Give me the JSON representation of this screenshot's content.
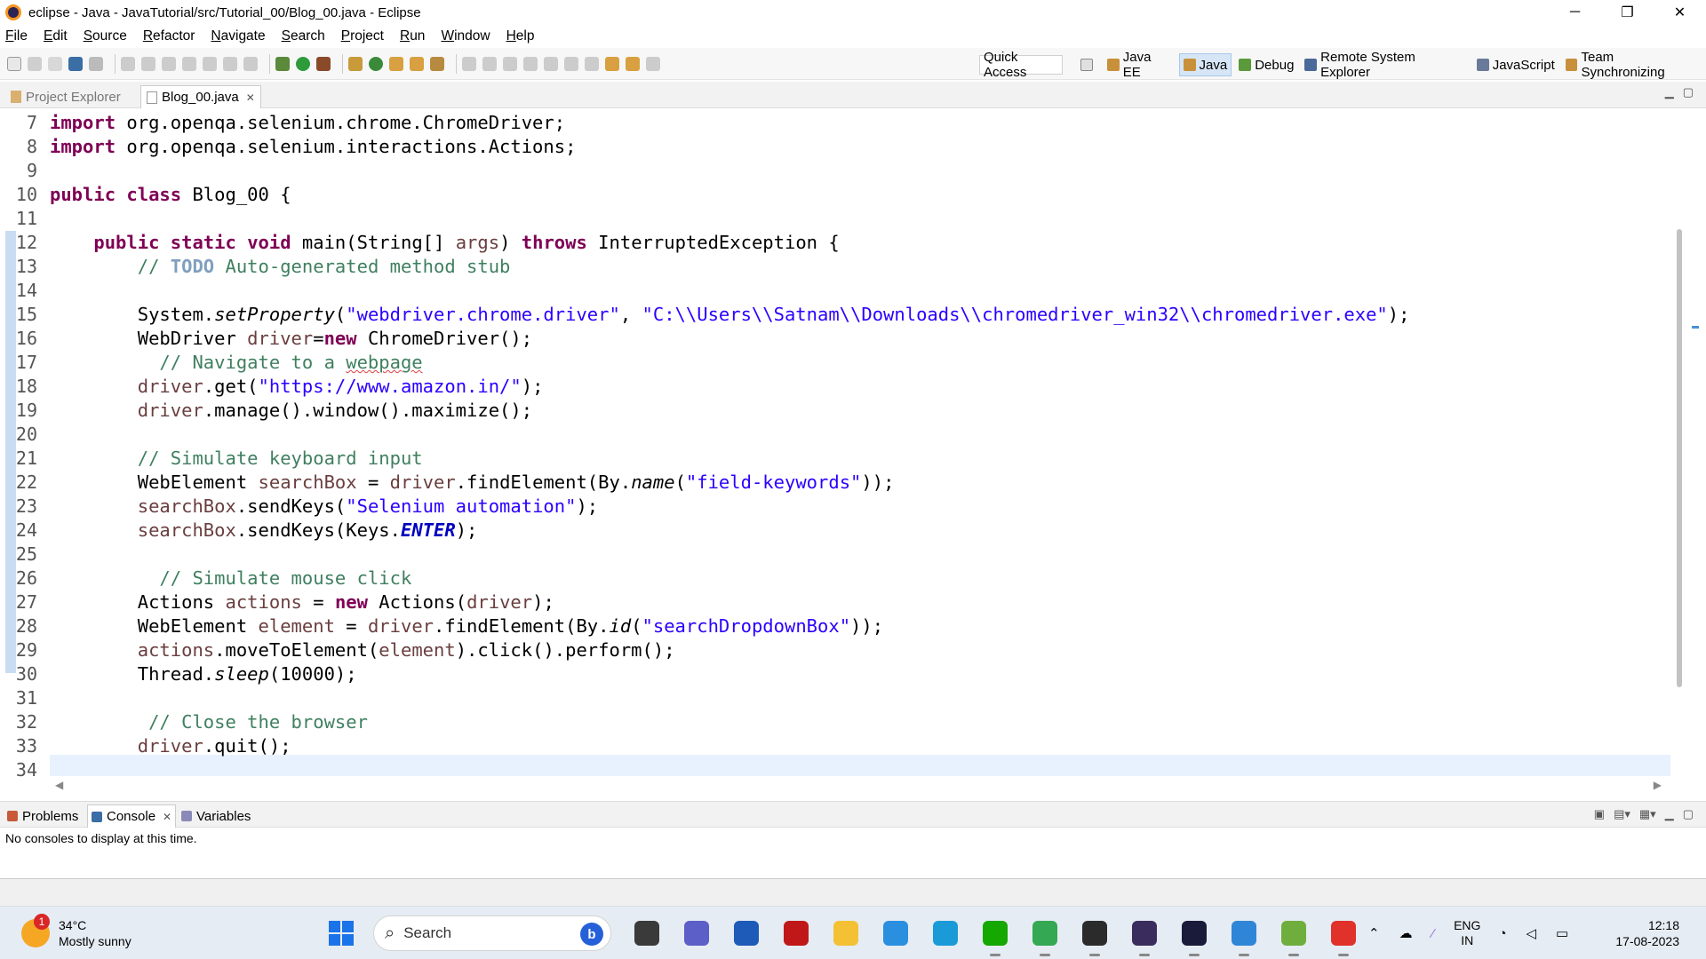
{
  "window": {
    "title": "eclipse - Java - JavaTutorial/src/Tutorial_00/Blog_00.java - Eclipse",
    "min": "─",
    "max": "❐",
    "close": "✕"
  },
  "menu": [
    "File",
    "Edit",
    "Source",
    "Refactor",
    "Navigate",
    "Search",
    "Project",
    "Run",
    "Window",
    "Help"
  ],
  "toolbar": {
    "quick_access": "Quick Access"
  },
  "perspectives": [
    {
      "label": "Java EE",
      "active": false
    },
    {
      "label": "Java",
      "active": true
    },
    {
      "label": "Debug",
      "active": false
    },
    {
      "label": "Remote System Explorer",
      "active": false
    },
    {
      "label": "JavaScript",
      "active": false
    },
    {
      "label": "Team Synchronizing",
      "active": false
    }
  ],
  "editor_tabs": {
    "project_explorer": "Project Explorer",
    "file": "Blog_00.java",
    "close": "✕"
  },
  "code": {
    "ln": [
      "7",
      "8",
      "9",
      "10",
      "11",
      "12",
      "13",
      "14",
      "15",
      "16",
      "17",
      "18",
      "19",
      "20",
      "21",
      "22",
      "23",
      "24",
      "25",
      "26",
      "27",
      "28",
      "29",
      "30",
      "31",
      "32",
      "33",
      "34"
    ],
    "imp1_kw": "import",
    "imp1": " org.openqa.selenium.chrome.ChromeDriver;",
    "imp2_kw": "import",
    "imp2": " org.openqa.selenium.interactions.Actions;",
    "cls_kw1": "public",
    "cls_kw2": "class",
    "cls": " Blog_00 {",
    "main_kw1": "public",
    "main_kw2": "static",
    "main_kw3": "void",
    "main_a": " main(String[] ",
    "main_args": "args",
    "main_b": ") ",
    "main_kw4": "throws",
    "main_c": " InterruptedException {",
    "todo_pre": "// ",
    "todo": "TODO",
    "todo_post": " Auto-generated method stub",
    "l15_a": "System.",
    "l15_m": "setProperty",
    "l15_b": "(",
    "l15_s1": "\"webdriver.chrome.driver\"",
    "l15_c": ", ",
    "l15_s2": "\"C:\\\\Users\\\\Satnam\\\\Downloads\\\\chromedriver_win32\\\\chromedriver.exe\"",
    "l15_d": ");",
    "l16_a": "WebDriver ",
    "l16_v": "driver",
    "l16_b": "=",
    "l16_kw": "new",
    "l16_c": " ChromeDriver();",
    "l17_a": "  // Navigate to a ",
    "l17_sq": "webpage",
    "l18_v": "driver",
    "l18_a": ".get(",
    "l18_s": "\"https://www.amazon.in/\"",
    "l18_b": ");",
    "l19_v": "driver",
    "l19_a": ".manage().window().maximize();",
    "l21": "// Simulate keyboard input",
    "l22_a": "WebElement ",
    "l22_v": "searchBox",
    "l22_b": " = ",
    "l22_v2": "driver",
    "l22_c": ".findElement(By.",
    "l22_m": "name",
    "l22_d": "(",
    "l22_s": "\"field-keywords\"",
    "l22_e": "));",
    "l23_v": "searchBox",
    "l23_a": ".sendKeys(",
    "l23_s": "\"Selenium automation\"",
    "l23_b": ");",
    "l24_v": "searchBox",
    "l24_a": ".sendKeys(Keys.",
    "l24_k": "ENTER",
    "l24_b": ");",
    "l26": "  // Simulate mouse click",
    "l27_a": "Actions ",
    "l27_v": "actions",
    "l27_b": " = ",
    "l27_kw": "new",
    "l27_c": " Actions(",
    "l27_v2": "driver",
    "l27_d": ");",
    "l28_a": "WebElement ",
    "l28_v": "element",
    "l28_b": " = ",
    "l28_v2": "driver",
    "l28_c": ".findElement(By.",
    "l28_m": "id",
    "l28_d": "(",
    "l28_s": "\"searchDropdownBox\"",
    "l28_e": "));",
    "l29_v": "actions",
    "l29_a": ".moveToElement(",
    "l29_v2": "element",
    "l29_b": ").click().perform();",
    "l30_a": "Thread.",
    "l30_m": "sleep",
    "l30_b": "(10000);",
    "l32": " // Close the browser",
    "l33_v": "driver",
    "l33_a": ".quit();"
  },
  "bottom_tabs": {
    "problems": "Problems",
    "console": "Console",
    "variables": "Variables",
    "close": "✕"
  },
  "console": {
    "message": "No consoles to display at this time."
  },
  "taskbar": {
    "weather_temp": "34°C",
    "weather_desc": "Mostly sunny",
    "weather_badge": "1",
    "search_placeholder": "Search",
    "bing": "b",
    "apps": [
      {
        "icon": "file-explorer-dark-icon",
        "color": "#3a3a3a",
        "open": false
      },
      {
        "icon": "teams-chat-icon",
        "color": "#5b5fc7",
        "open": false
      },
      {
        "icon": "microsoft-store-icon",
        "color": "#1e5bb8",
        "open": false
      },
      {
        "icon": "mcafee-icon",
        "color": "#c01818",
        "open": false
      },
      {
        "icon": "folder-icon",
        "color": "#f3c133",
        "open": false
      },
      {
        "icon": "paint-icon",
        "color": "#2b8fe0",
        "open": false
      },
      {
        "icon": "edge-icon",
        "color": "#1a9bd8",
        "open": false
      },
      {
        "icon": "upwork-icon",
        "color": "#14a800",
        "open": true
      },
      {
        "icon": "chrome-icon",
        "color": "#34a853",
        "open": true
      },
      {
        "icon": "terminal-icon",
        "color": "#2b2b2b",
        "open": true
      },
      {
        "icon": "eclipse-icon",
        "color": "#3b2c5e",
        "open": true
      },
      {
        "icon": "intellij-icon",
        "color": "#1a1a3a",
        "open": true
      },
      {
        "icon": "notepad-icon",
        "color": "#2f86d6",
        "open": true
      },
      {
        "icon": "editor-icon",
        "color": "#6fae3c",
        "open": true
      },
      {
        "icon": "anydesk-icon",
        "color": "#e0312b",
        "open": true
      }
    ],
    "lang_top": "ENG",
    "lang_bottom": "IN",
    "time": "12:18",
    "date": "17-08-2023"
  }
}
